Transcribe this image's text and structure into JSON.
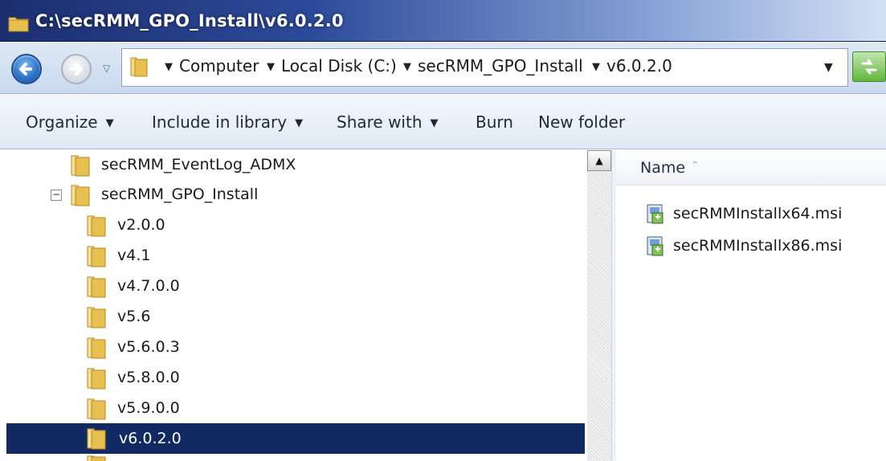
{
  "window": {
    "title": "C:\\secRMM_GPO_Install\\v6.0.2.0"
  },
  "address_bar": {
    "crumbs": [
      "Computer",
      "Local Disk (C:)",
      "secRMM_GPO_Install",
      "v6.0.2.0"
    ]
  },
  "toolbar": {
    "organize": "Organize",
    "include_in_library": "Include in library",
    "share_with": "Share with",
    "burn": "Burn",
    "new_folder": "New folder"
  },
  "tree": {
    "items": [
      {
        "label": "secRMM_EventLog_ADMX"
      },
      {
        "label": "secRMM_GPO_Install"
      },
      {
        "label": "v2.0.0"
      },
      {
        "label": "v4.1"
      },
      {
        "label": "v4.7.0.0"
      },
      {
        "label": "v5.6"
      },
      {
        "label": "v5.6.0.3"
      },
      {
        "label": "v5.8.0.0"
      },
      {
        "label": "v5.9.0.0"
      },
      {
        "label": "v6.0.2.0"
      }
    ],
    "selected": "v6.0.2.0",
    "expander_symbol": "−"
  },
  "file_list": {
    "column_name": "Name",
    "sort_indicator": "^",
    "files": [
      {
        "name": "secRMMInstallx64.msi",
        "icon": "msi-installer-icon"
      },
      {
        "name": "secRMMInstallx86.msi",
        "icon": "msi-installer-icon"
      }
    ]
  },
  "colors": {
    "selection": "#112b62",
    "folder": "#e8c558",
    "title_bar_start": "#1c2e6e"
  }
}
